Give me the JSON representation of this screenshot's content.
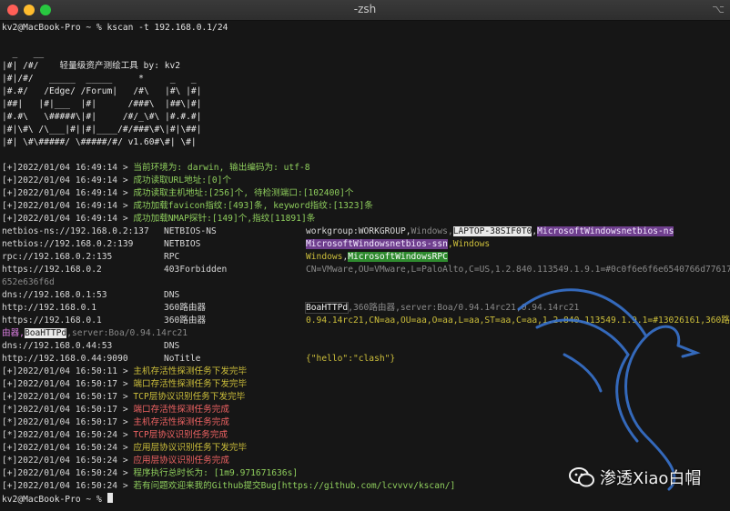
{
  "window": {
    "title": "-zsh",
    "corner_glyph": "⌥"
  },
  "prompt1": "kv2@MacBook-Pro ~ % kscan -t 192.168.0.1/24",
  "banner": [
    "  _   __",
    "|#| /#/    轻量级资产测绘工具 by: kv2",
    "|#|/#/   _____  _____     *     _   _",
    "|#.#/   /Edge/ /Forum|   /#\\   |#\\ |#|",
    "|##|   |#|___  |#|      /###\\  |##\\|#|",
    "|#.#\\   \\#####\\|#|     /#/_\\#\\ |#.#.#|",
    "|#|\\#\\ /\\___|#||#|____/#/###\\#\\|#|\\##|",
    "|#| \\#\\#####/ \\#####/#/ v1.60#\\#| \\#|"
  ],
  "log_start": [
    {
      "prefix": "[+]2022/01/04 16:49:14 > ",
      "msg": "当前环境为: darwin, 输出编码为: utf-8"
    },
    {
      "prefix": "[+]2022/01/04 16:49:14 > ",
      "msg": "成功读取URL地址:[0]个"
    },
    {
      "prefix": "[+]2022/01/04 16:49:14 > ",
      "msg": "成功读取主机地址:[256]个, 待检测端口:[102400]个"
    },
    {
      "prefix": "[+]2022/01/04 16:49:14 > ",
      "msg": "成功加载favicon指纹:[493]条, keyword指纹:[1323]条"
    },
    {
      "prefix": "[+]2022/01/04 16:49:14 > ",
      "msg": "成功加载NMAP探针:[149]个,指纹[11891]条"
    }
  ],
  "results": {
    "r1": {
      "url": "netbios-ns://192.168.0.2:137",
      "service": "NETBIOS-NS",
      "a": "workgroup:WORKGROUP,",
      "b": "Windows,",
      "c": "LAPTOP-38SIF0T0",
      "d": ",",
      "e": "MicrosoftWindowsnetbios-ns"
    },
    "r2": {
      "url": "netbios://192.168.0.2:139",
      "service": "NETBIOS",
      "a": "MicrosoftWindowsnetbios-ssn",
      "b": ",Windows"
    },
    "r3": {
      "url": "rpc://192.168.0.2:135",
      "service": "RPC",
      "a": "Windows",
      "b": ",",
      "c": "MicrosoftWindowsRPC"
    },
    "r4": {
      "url": "https://192.168.0.2",
      "service": "403Forbidden",
      "a": "CN=VMware,OU=VMware,L=PaloAlto,C=US,1.2.840.113549.1.9.1=#0c0f6e6f6e6540766d77617",
      "b": "652e636f6d"
    },
    "r5": {
      "url": "dns://192.168.0.1:53",
      "service": "DNS"
    },
    "r6": {
      "url": "http://192.168.0.1",
      "service": "360路由器",
      "a": "BoaHTTPd",
      "b": ",360路由器,server:Boa/0.94.14rc21,0.94.14rc21"
    },
    "r7": {
      "url": "https://192.168.0.1",
      "service": "360路由器",
      "a": "0.94.14rc21,CN=aa,OU=aa,O=aa,L=aa,ST=aa,C=aa,1.2.840.113549.1.9.1=#13026161,360路",
      "b1": "由器,",
      "b2": "BoaHTTPd",
      "b3": ",server:Boa/0.94.14rc21"
    },
    "r8": {
      "url": "dns://192.168.0.44:53",
      "service": "DNS"
    },
    "r9": {
      "url": "http://192.168.0.44:9090",
      "service": "NoTitle",
      "a": "{\"hello\":\"clash\"}"
    }
  },
  "log_end": [
    {
      "prefix": "[+]2022/01/04 16:50:11 > ",
      "msg": "主机存活性探测任务下发完毕",
      "color": "y"
    },
    {
      "prefix": "[+]2022/01/04 16:50:17 > ",
      "msg": "端口存活性探测任务下发完毕",
      "color": "y"
    },
    {
      "prefix": "[+]2022/01/04 16:50:17 > ",
      "msg": "TCP层协议识别任务下发完毕",
      "color": "y"
    },
    {
      "prefix": "[*]2022/01/04 16:50:17 > ",
      "msg": "端口存活性探测任务完成",
      "color": "r"
    },
    {
      "prefix": "[*]2022/01/04 16:50:17 > ",
      "msg": "主机存活性探测任务完成",
      "color": "r"
    },
    {
      "prefix": "[*]2022/01/04 16:50:24 > ",
      "msg": "TCP层协议识别任务完成",
      "color": "r"
    },
    {
      "prefix": "[+]2022/01/04 16:50:24 > ",
      "msg": "应用层协议识别任务下发完毕",
      "color": "y"
    },
    {
      "prefix": "[*]2022/01/04 16:50:24 > ",
      "msg": "应用层协议识别任务完成",
      "color": "r"
    },
    {
      "prefix": "[+]2022/01/04 16:50:24 > ",
      "msg": "程序执行总时长为: [1m9.971671636s]",
      "color": "g"
    },
    {
      "prefix": "[+]2022/01/04 16:50:24 > ",
      "msg": "若有问题欢迎来我的Github提交Bug[https://github.com/lcvvvv/kscan/]",
      "color": "g"
    }
  ],
  "prompt2": "kv2@MacBook-Pro ~ % ",
  "watermark": "渗透Xiao白帽",
  "colors": {
    "accent_purple": "#6f3f8e",
    "accent_green": "#2e8a2e",
    "log_green": "#8fce5d",
    "log_yellow": "#cdbf3b",
    "log_red": "#ef6363"
  }
}
